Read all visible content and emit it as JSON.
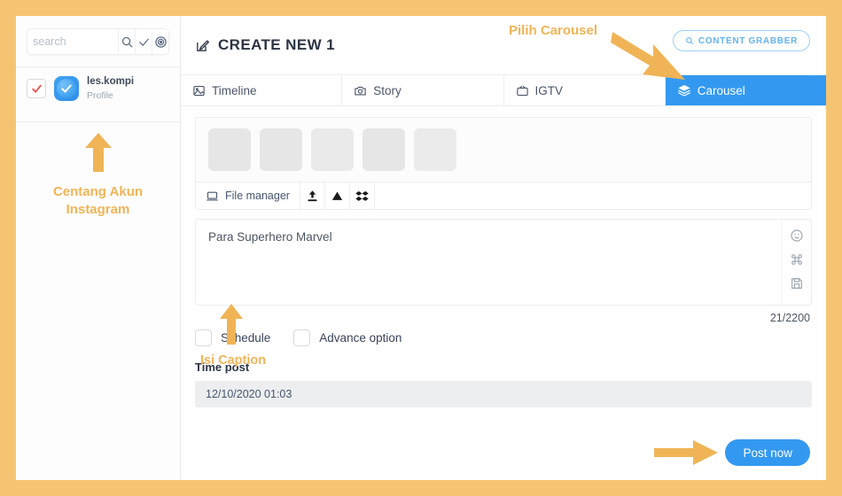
{
  "theme": {
    "frame_border": "#F5C473",
    "accent_blue": "#3399F0",
    "annotation_orange": "#F0B456",
    "checkbox_red": "#EE4B4B"
  },
  "sidebar": {
    "search": {
      "value": "",
      "placeholder": "search",
      "icons": [
        "search-icon",
        "check-icon",
        "target-icon"
      ]
    },
    "accounts": [
      {
        "name": "les.kompi",
        "subtitle": "Profile",
        "checked": true,
        "avatar": "instagram-account-avatar"
      }
    ],
    "annotation": {
      "line1": "Centang Akun",
      "line2": "Instagram",
      "arrow": "arrow-up"
    }
  },
  "header": {
    "title": "CREATE NEW 1",
    "title_icon": "edit-square-icon",
    "content_grabber": {
      "label": "CONTENT GRABBER",
      "icon": "search-icon"
    },
    "annotation": {
      "text": "Pilih Carousel",
      "arrow": "arrow-diagonal-down-right"
    }
  },
  "tabs": [
    {
      "label": "Timeline",
      "icon": "image-icon",
      "active": false
    },
    {
      "label": "Story",
      "icon": "camera-icon",
      "active": false
    },
    {
      "label": "IGTV",
      "icon": "tv-icon",
      "active": false
    },
    {
      "label": "Carousel",
      "icon": "layers-icon",
      "active": true
    }
  ],
  "media": {
    "thumbnail_count": 5,
    "file_manager": {
      "label": "File manager",
      "icon": "monitor-icon"
    },
    "sources": [
      "upload-icon",
      "google-drive-icon",
      "dropbox-icon"
    ]
  },
  "caption": {
    "value": "Para Superhero Marvel",
    "placeholder": "",
    "tools": [
      "emoji-icon",
      "hashtag-command-icon",
      "save-icon"
    ],
    "counter": "21/2200",
    "annotation": {
      "text": "Isi Caption",
      "arrow": "arrow-up"
    }
  },
  "options": {
    "schedule": {
      "label": "Schedule",
      "checked": false
    },
    "advance": {
      "label": "Advance option",
      "checked": false
    }
  },
  "time_post": {
    "label": "Time post",
    "value": "12/10/2020 01:03"
  },
  "footer": {
    "post_label": "Post now",
    "arrow": "arrow-right"
  }
}
